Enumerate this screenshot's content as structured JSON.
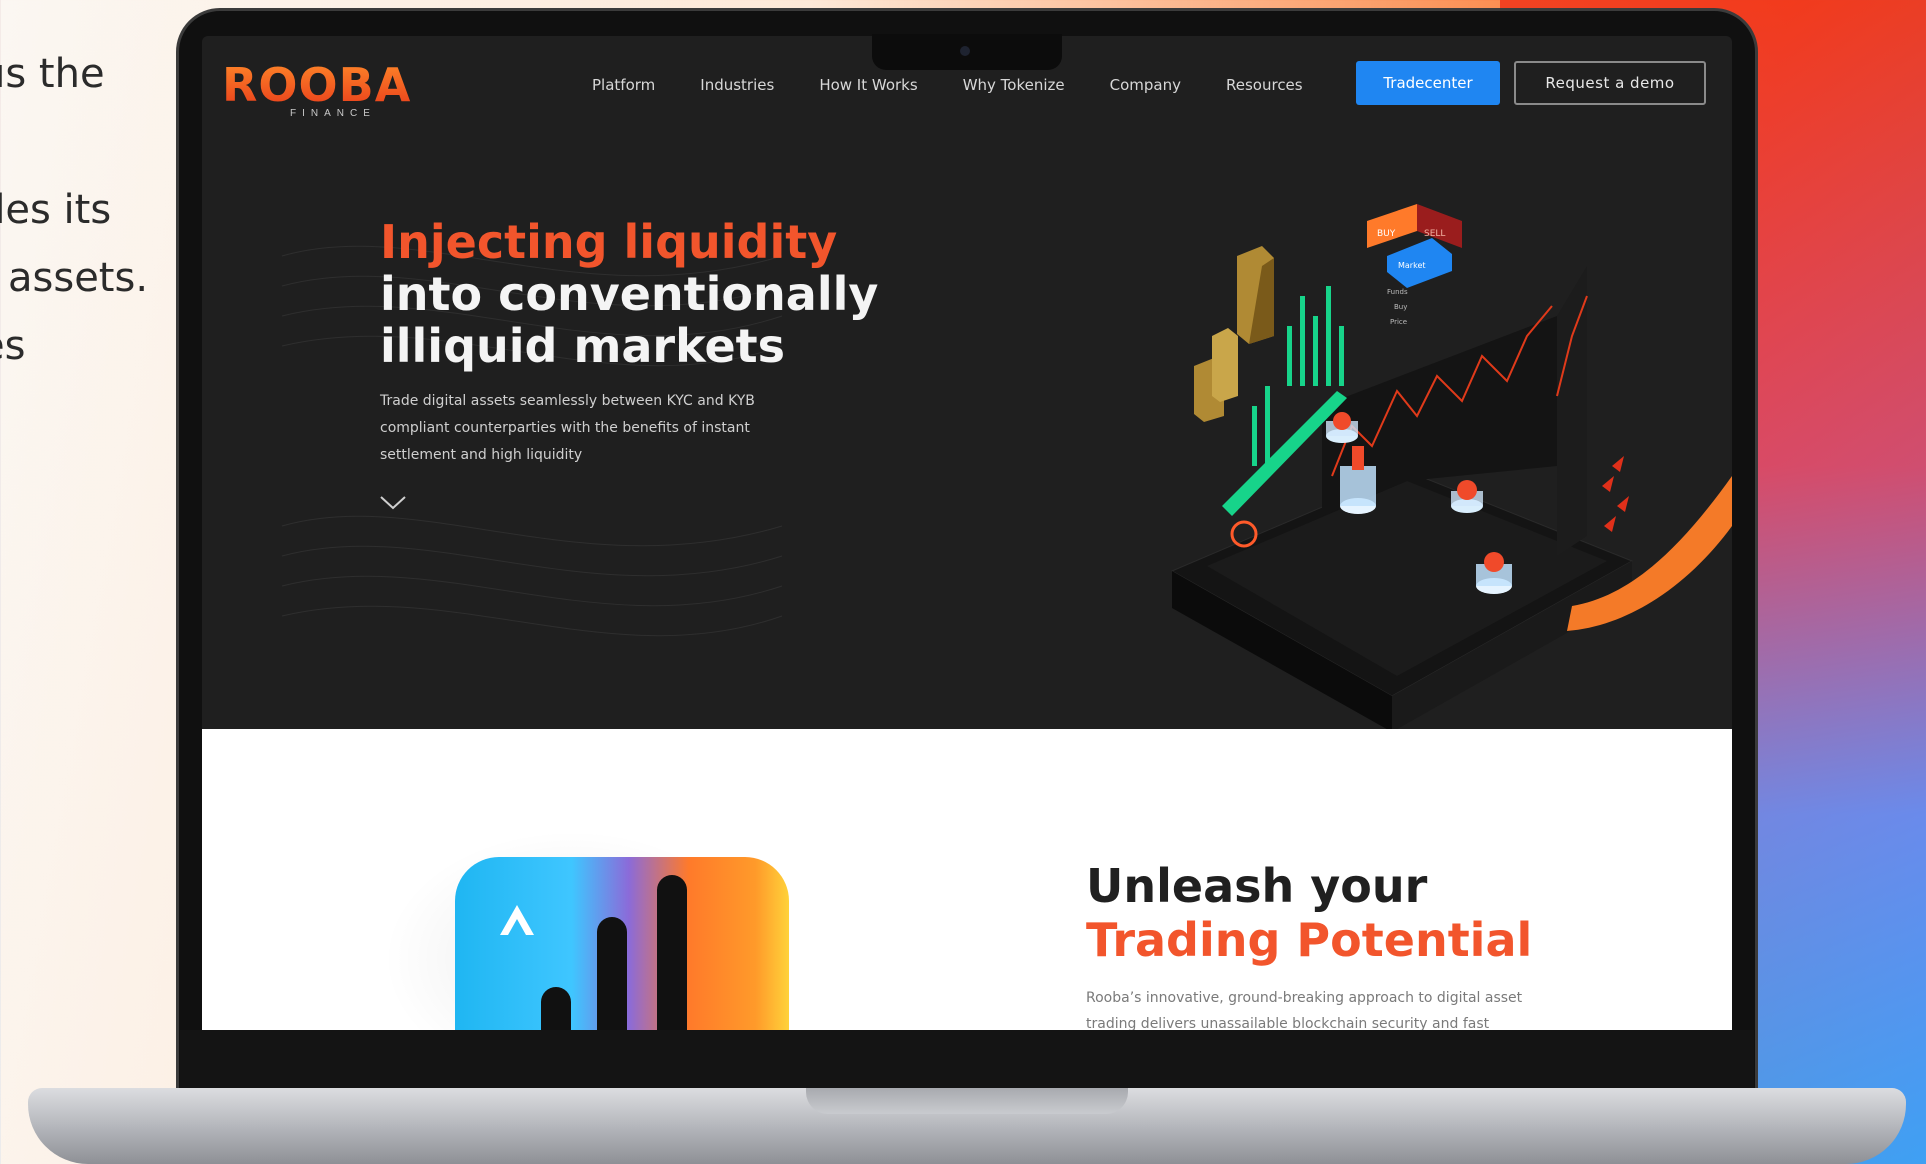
{
  "side_text": {
    "lines": [
      "us the",
      "des its",
      "assets.",
      "es"
    ]
  },
  "nav": {
    "logo_word": "ROOBA",
    "logo_sub": "FINANCE",
    "links": [
      "Platform",
      "Industries",
      "How It Works",
      "Why Tokenize",
      "Company",
      "Resources"
    ],
    "tradecenter_label": "Tradecenter",
    "demo_label": "Request a demo"
  },
  "hero": {
    "title_accent": "Injecting liquidity",
    "title_line2": "into conventionally",
    "title_line3": "illiquid markets",
    "description": "Trade digital assets seamlessly between KYC and KYB compliant counterparties with the benefits of instant settlement and high liquidity",
    "art": {
      "buy_label": "BUY",
      "sell_label": "SELL",
      "market_label": "Market",
      "menu_items": [
        "Funds",
        "Buy",
        "Price"
      ]
    }
  },
  "section": {
    "title_line1": "Unleash your",
    "title_line2": "Trading Potential",
    "description": "Rooba’s innovative, ground-breaking approach to digital asset trading delivers unassailable blockchain security and fast"
  },
  "colors": {
    "accent": "#f2552c",
    "primary_button": "#1f86f2",
    "screen_bg": "#1f1f1f"
  }
}
